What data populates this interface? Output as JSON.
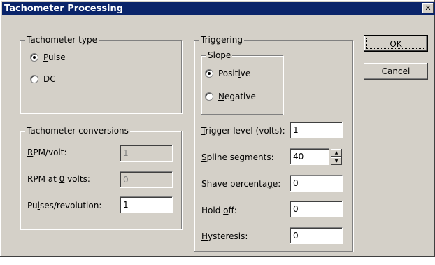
{
  "window": {
    "title": "Tachometer Processing",
    "close_glyph": "✕"
  },
  "tachometer_type": {
    "legend": "Tachometer type",
    "options": [
      {
        "pre": "",
        "key": "P",
        "post": "ulse",
        "checked": true
      },
      {
        "pre": "",
        "key": "D",
        "post": "C",
        "checked": false
      }
    ]
  },
  "tachometer_conversions": {
    "legend": "Tachometer conversions",
    "rpm_per_volt": {
      "pre": "",
      "key": "R",
      "post": "PM/volt:",
      "value": "1",
      "disabled": true
    },
    "rpm_at_zero": {
      "pre": "RPM at ",
      "key": "0",
      "post": " volts:",
      "value": "0",
      "disabled": true
    },
    "pulses_per_rev": {
      "pre": "Pu",
      "key": "l",
      "post": "ses/revolution:",
      "value": "1",
      "disabled": false
    }
  },
  "triggering": {
    "legend": "Triggering",
    "slope": {
      "legend": "Slope",
      "options": [
        {
          "pre": "Posit",
          "key": "i",
          "post": "ve",
          "checked": true
        },
        {
          "pre": "",
          "key": "N",
          "post": "egative",
          "checked": false
        }
      ]
    },
    "trigger_level": {
      "pre": "",
      "key": "T",
      "post": "rigger level (volts):",
      "value": "1"
    },
    "spline_segments": {
      "pre": "",
      "key": "S",
      "post": "pline segments:",
      "value": "40"
    },
    "shave_percentage": {
      "pre": "Shave percenta",
      "key": "g",
      "post": "e:",
      "value": "0"
    },
    "hold_off": {
      "pre": "Hold ",
      "key": "o",
      "post": "ff:",
      "value": "0"
    },
    "hysteresis": {
      "pre": "",
      "key": "H",
      "post": "ysteresis:",
      "value": "0"
    }
  },
  "buttons": {
    "ok": "OK",
    "cancel": "Cancel"
  },
  "spin_glyphs": {
    "up": "▲",
    "down": "▼"
  },
  "colors": {
    "face": "#d4d0c8",
    "titlebar": "#0a246a"
  }
}
